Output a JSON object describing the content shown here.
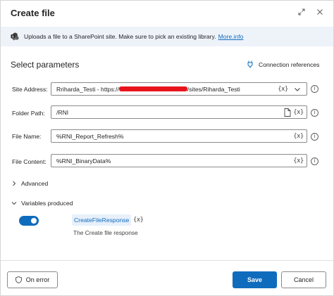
{
  "dialog": {
    "title": "Create file"
  },
  "info": {
    "text": "Uploads a file to a SharePoint site. Make sure to pick an existing library.",
    "link": "More.info"
  },
  "params": {
    "section_title": "Select parameters",
    "connection_references": "Connection references"
  },
  "fields": {
    "site_address": {
      "label": "Site Address:",
      "value_prefix": "Rriharda_Testi - https://",
      "value_suffix": "/sites/Riharda_Testi",
      "var_tag": "{x}"
    },
    "folder_path": {
      "label": "Folder Path:",
      "value": "/RNI",
      "var_tag": "{x}"
    },
    "file_name": {
      "label": "File Name:",
      "value": "%RNI_Report_Refresh%",
      "var_tag": "{x}"
    },
    "file_content": {
      "label": "File Content:",
      "value": "%RNI_BinaryData%",
      "var_tag": "{x}"
    }
  },
  "advanced": {
    "label": "Advanced"
  },
  "variables": {
    "label": "Variables produced",
    "toggle_on": true,
    "name": "CreateFileResponse",
    "var_tag": "{x}",
    "description": "The Create file response"
  },
  "footer": {
    "on_error": "On error",
    "save": "Save",
    "cancel": "Cancel"
  },
  "colors": {
    "accent": "#0f6cbd",
    "info_bg": "#eef3fa",
    "redaction": "#e8141c"
  }
}
